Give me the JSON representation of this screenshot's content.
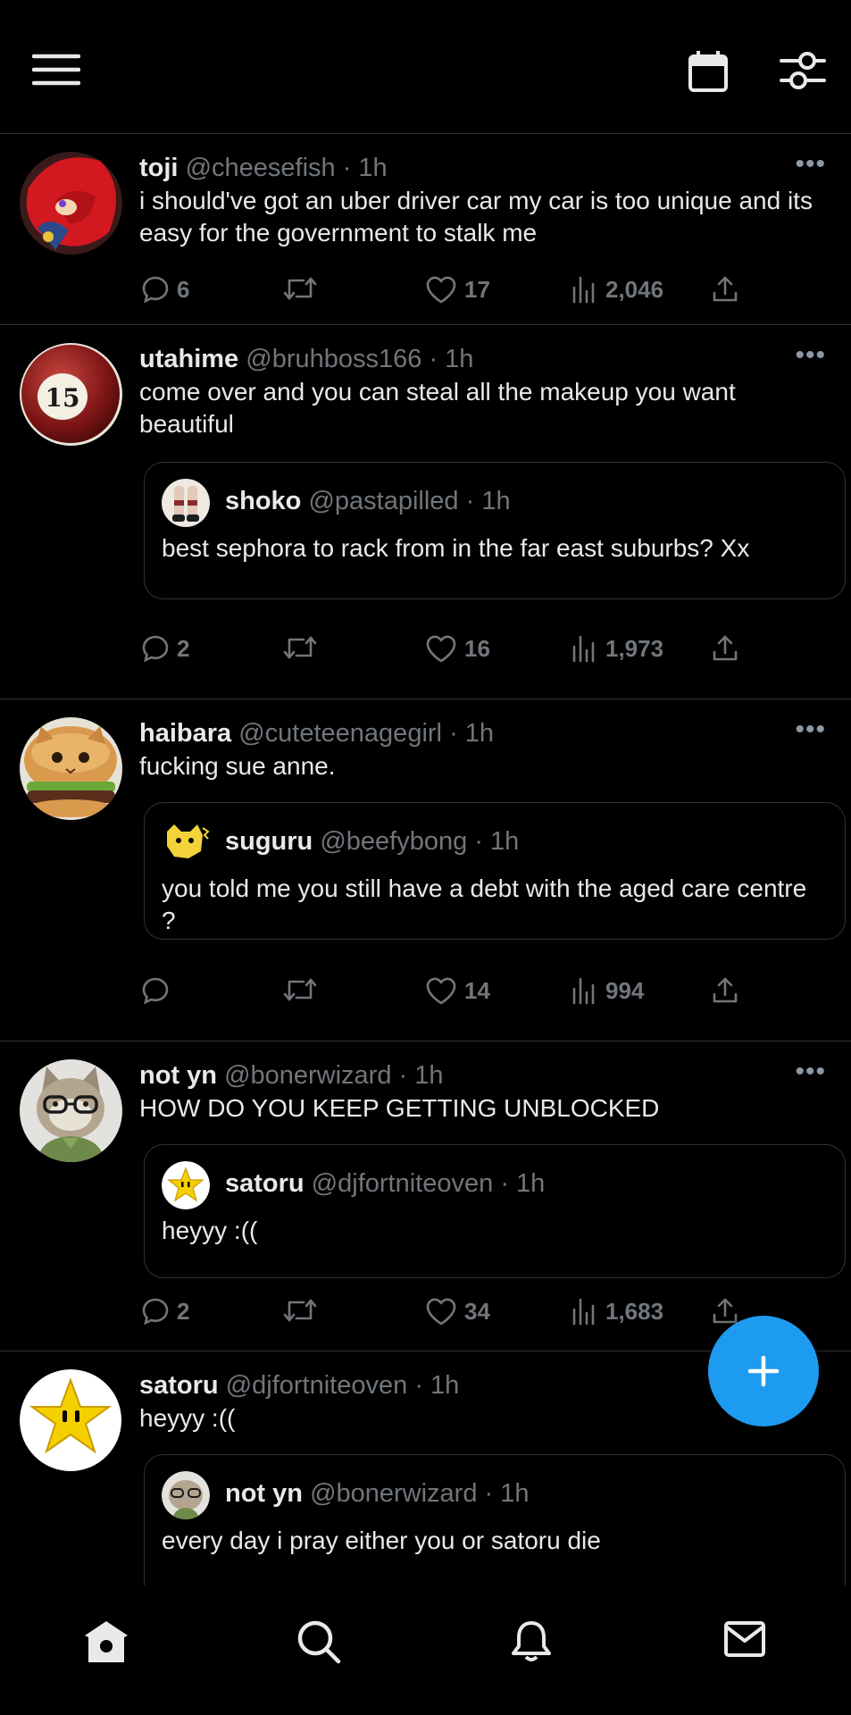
{
  "topbar": {
    "menu_icon": "hamburger-icon",
    "calendar_icon": "calendar-icon",
    "settings_icon": "sliders-icon"
  },
  "tweets": [
    {
      "name": "toji",
      "handle": "@cheesefish",
      "time": "· 1h",
      "text": "i should've got an uber driver car my car is too unique and its easy for the government to stalk me",
      "replies": "6",
      "likes": "17",
      "views": "2,046"
    },
    {
      "name": "utahime",
      "handle": "@bruhboss166",
      "time": "· 1h",
      "text": "come over and you can steal all the makeup you want beautiful",
      "quote": {
        "name": "shoko",
        "handle": "@pastapilled",
        "time": "· 1h",
        "text": "best sephora to rack from in the far east suburbs? Xx"
      },
      "replies": "2",
      "likes": "16",
      "views": "1,973",
      "avatar_ball_number": "15"
    },
    {
      "name": "haibara",
      "handle": "@cuteteenagegirl",
      "time": "· 1h",
      "text": "fucking sue anne.",
      "quote": {
        "name": "suguru",
        "handle": "@beefybong",
        "time": "· 1h",
        "text": "you told me you still have a debt with the aged care centre ?"
      },
      "replies": "",
      "likes": "14",
      "views": "994"
    },
    {
      "name": "not yn",
      "handle": "@bonerwizard",
      "time": "· 1h",
      "text": "HOW DO YOU KEEP GETTING UNBLOCKED",
      "quote": {
        "name": "satoru",
        "handle": "@djfortniteoven",
        "time": "· 1h",
        "text": "heyyy :(("
      },
      "replies": "2",
      "likes": "34",
      "views": "1,683"
    },
    {
      "name": "satoru",
      "handle": "@djfortniteoven",
      "time": "· 1h",
      "text": "heyyy :((",
      "quote": {
        "name": "not yn",
        "handle": "@bonerwizard",
        "time": "· 1h",
        "text": "every day i pray either you or satoru die"
      }
    }
  ],
  "more_label": "•••",
  "bottom_nav": [
    "home-icon",
    "search-icon",
    "bell-icon",
    "mail-icon"
  ],
  "colors": {
    "accent": "#1d9bf0",
    "background": "#000000",
    "muted": "#71767b",
    "divider": "#2f3336"
  }
}
